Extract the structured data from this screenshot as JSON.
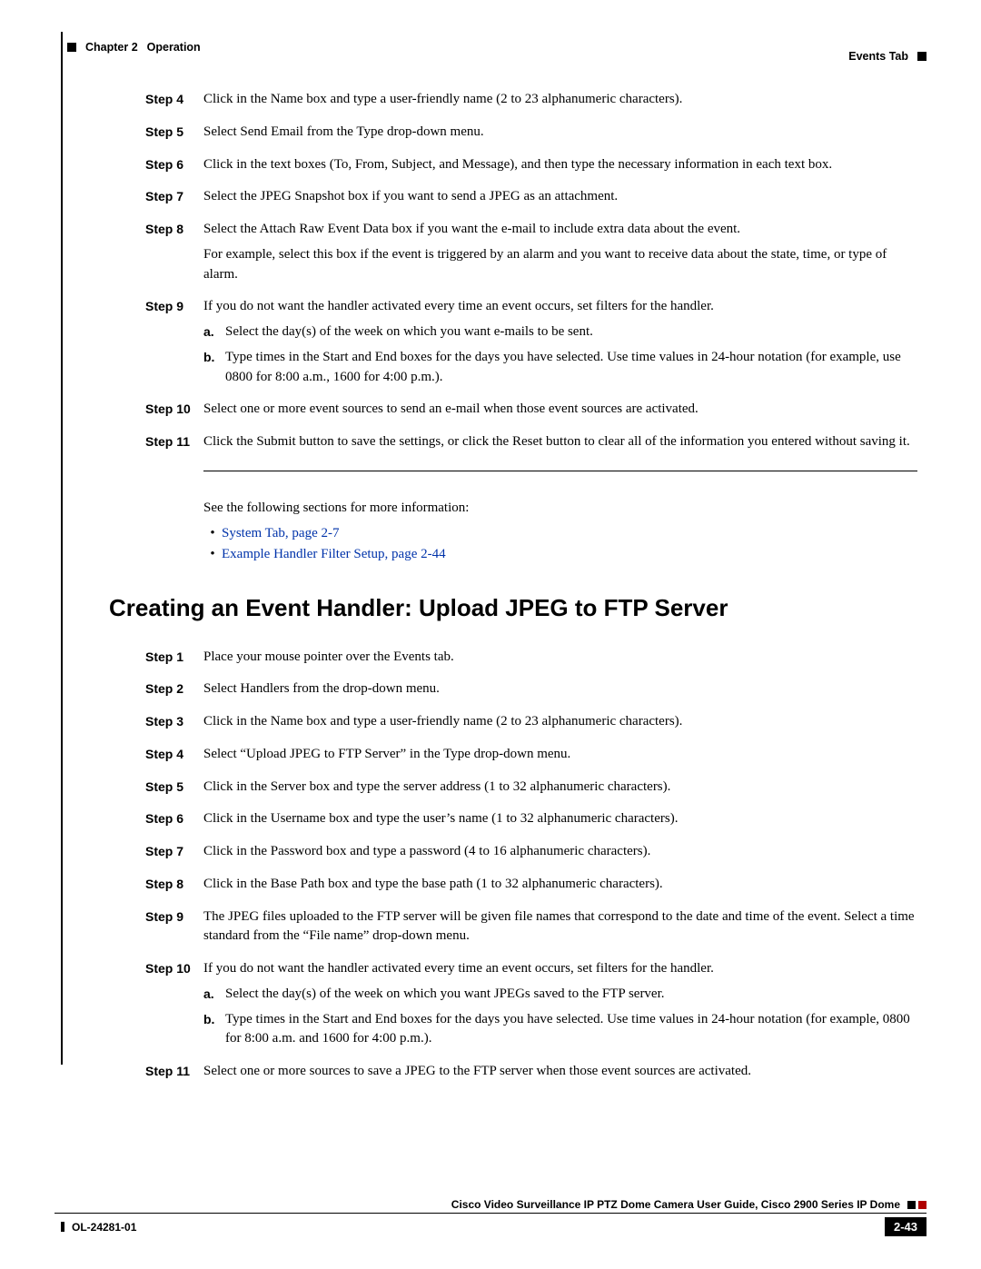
{
  "header": {
    "chapter": "Chapter 2",
    "section": "Operation",
    "tab": "Events Tab"
  },
  "steps_a": [
    {
      "label": "Step 4",
      "paras": [
        "Click in the Name box and type a user-friendly name (2 to 23 alphanumeric characters)."
      ]
    },
    {
      "label": "Step 5",
      "paras": [
        "Select Send Email from the Type drop-down menu."
      ]
    },
    {
      "label": "Step 6",
      "paras": [
        "Click in the text boxes (To, From, Subject, and Message), and then type the necessary information in each text box."
      ]
    },
    {
      "label": "Step 7",
      "paras": [
        "Select the JPEG Snapshot box if you want to send a JPEG as an attachment."
      ]
    },
    {
      "label": "Step 8",
      "paras": [
        "Select the Attach Raw Event Data box if you want the e-mail to include extra data about the event.",
        "For example, select this box if the event is triggered by an alarm and you want to receive data about the state, time, or type of alarm."
      ]
    },
    {
      "label": "Step 9",
      "paras": [
        "If you do not want the handler activated every time an event occurs, set filters for the handler."
      ],
      "subs": [
        {
          "label": "a.",
          "text": "Select the day(s) of the week on which you want e-mails to be sent."
        },
        {
          "label": "b.",
          "text": "Type times in the Start and End boxes for the days you have selected. Use time values in 24-hour notation (for example, use 0800 for 8:00 a.m., 1600 for 4:00 p.m.)."
        }
      ]
    },
    {
      "label": "Step 10",
      "paras": [
        "Select one or more event sources to send an e-mail when those event sources are activated."
      ]
    },
    {
      "label": "Step 11",
      "paras": [
        "Click the Submit button to save the settings, or click the Reset button to clear all of the information you entered without saving it."
      ]
    }
  ],
  "intro2": "See the following sections for more information:",
  "links": [
    "System Tab, page 2-7",
    "Example Handler Filter Setup, page 2-44"
  ],
  "section_title": "Creating an Event Handler: Upload JPEG to FTP Server",
  "steps_b": [
    {
      "label": "Step 1",
      "paras": [
        "Place your mouse pointer over the Events tab."
      ]
    },
    {
      "label": "Step 2",
      "paras": [
        "Select Handlers from the drop-down menu."
      ]
    },
    {
      "label": "Step 3",
      "paras": [
        "Click in the Name box and type a user-friendly name (2 to 23 alphanumeric characters)."
      ]
    },
    {
      "label": "Step 4",
      "paras": [
        "Select “Upload JPEG to FTP Server” in the Type drop-down menu."
      ]
    },
    {
      "label": "Step 5",
      "paras": [
        "Click in the Server box and type the server address (1 to 32 alphanumeric characters)."
      ]
    },
    {
      "label": "Step 6",
      "paras": [
        "Click in the Username box and type the user’s name (1 to 32 alphanumeric characters)."
      ]
    },
    {
      "label": "Step 7",
      "paras": [
        "Click in the Password box and type a password (4 to 16 alphanumeric characters)."
      ]
    },
    {
      "label": "Step 8",
      "paras": [
        "Click in the Base Path box and type the base path (1 to 32 alphanumeric characters)."
      ]
    },
    {
      "label": "Step 9",
      "paras": [
        "The JPEG files uploaded to the FTP server will be given file names that correspond to the date and time of the event. Select a time standard from the “File name” drop-down menu."
      ]
    },
    {
      "label": "Step 10",
      "paras": [
        "If you do not want the handler activated every time an event occurs, set filters for the handler."
      ],
      "subs": [
        {
          "label": "a.",
          "text": "Select the day(s) of the week on which you want JPEGs saved to the FTP server."
        },
        {
          "label": "b.",
          "text": "Type times in the Start and End boxes for the days you have selected. Use time values in 24-hour notation (for example, 0800 for 8:00 a.m. and 1600 for 4:00 p.m.)."
        }
      ]
    },
    {
      "label": "Step 11",
      "paras": [
        "Select one or more sources to save a JPEG to the FTP server when those event sources are activated."
      ]
    }
  ],
  "footer": {
    "doc_title": "Cisco Video Surveillance IP PTZ Dome Camera User Guide, Cisco 2900 Series IP Dome",
    "doc_id": "OL-24281-01",
    "page_num": "2-43"
  }
}
